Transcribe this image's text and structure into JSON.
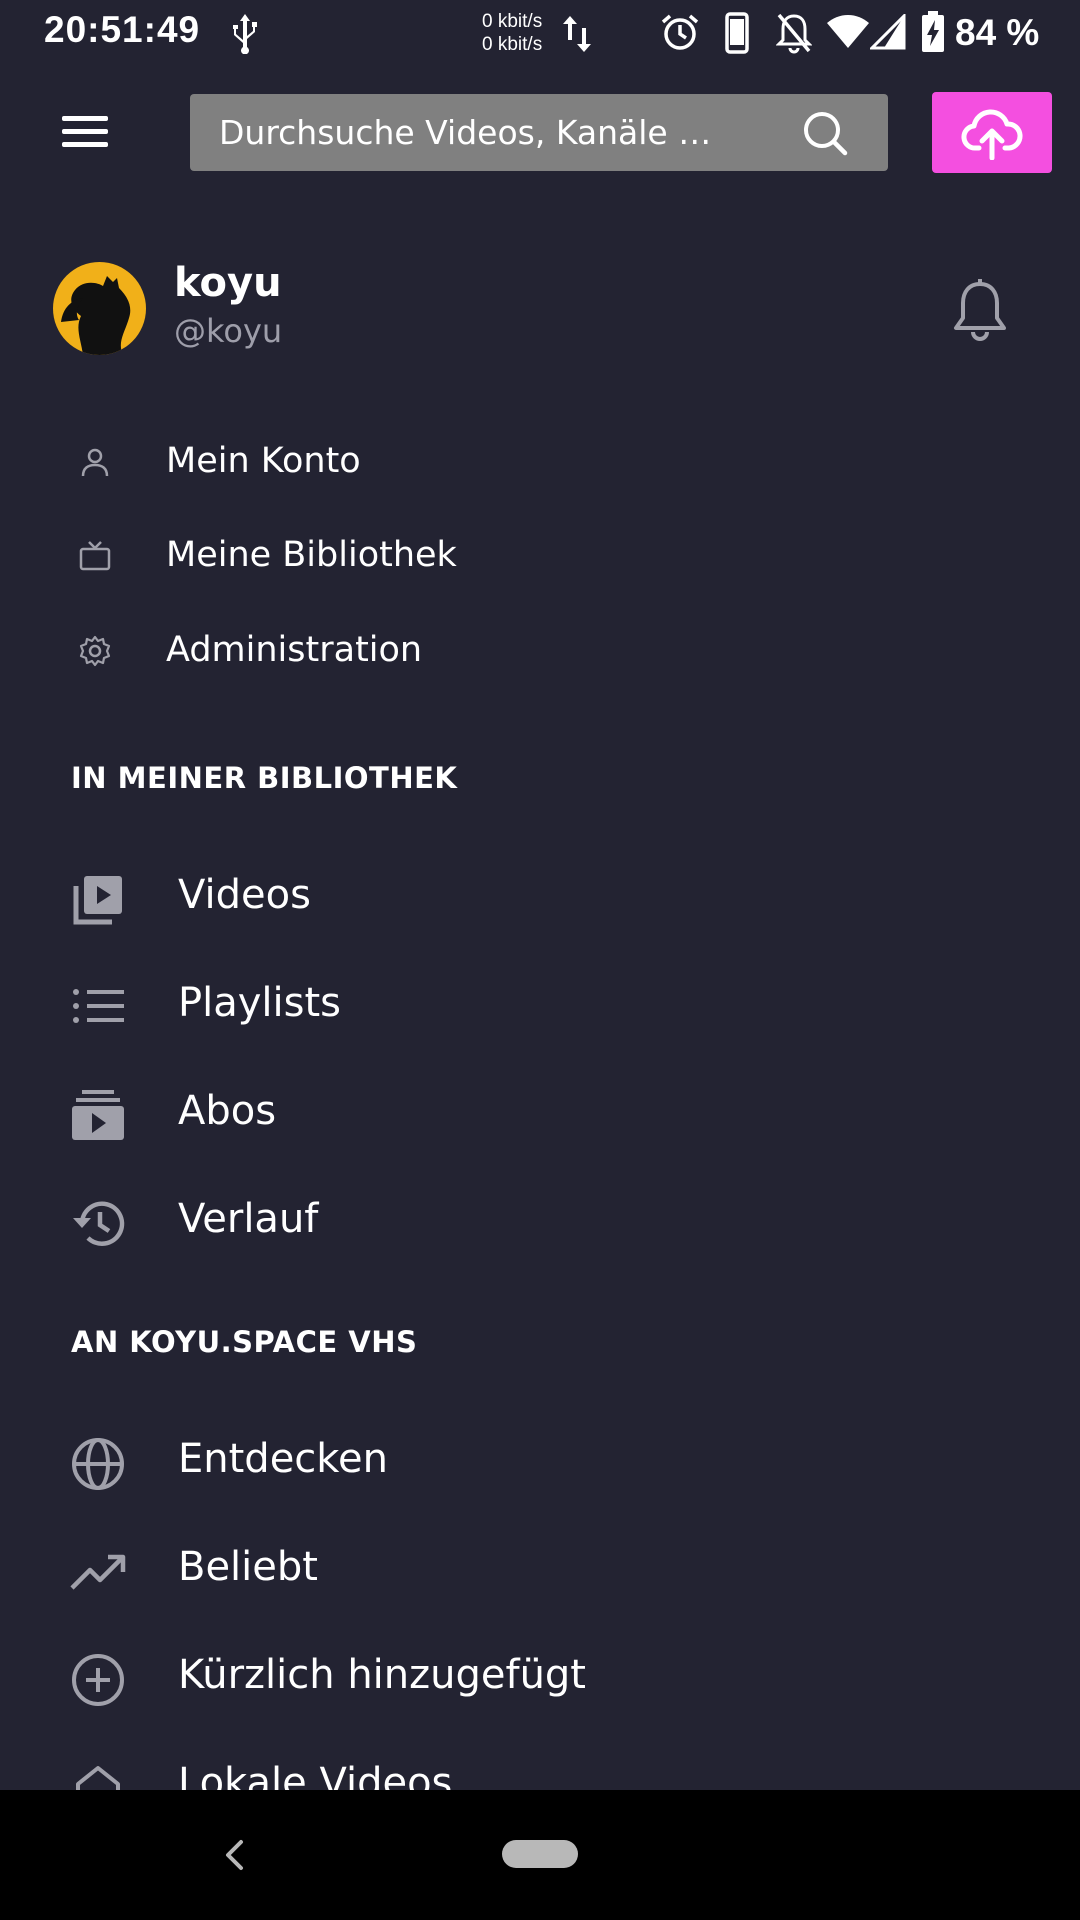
{
  "status_bar": {
    "time": "20:51:49",
    "net_up": "0 kbit/s",
    "net_down": "0 kbit/s",
    "battery": "84 %",
    "icons": [
      "usb-icon",
      "data-transfer-icon",
      "alarm-icon",
      "phone-icon",
      "bell-off-icon",
      "wifi-icon",
      "signal-icon",
      "battery-charging-icon"
    ]
  },
  "header": {
    "search_placeholder": "Durchsuche Videos, Kanäle …",
    "icons": [
      "menu-icon",
      "search-icon",
      "upload-cloud-icon"
    ],
    "upload_color": "#f44fe0"
  },
  "profile": {
    "name": "koyu",
    "handle": "@koyu",
    "avatar_color": "#f1b019"
  },
  "account_menu": [
    {
      "label": "Mein Konto",
      "icon": "user-icon"
    },
    {
      "label": "Meine Bibliothek",
      "icon": "tv-icon"
    },
    {
      "label": "Administration",
      "icon": "gear-icon"
    }
  ],
  "library": {
    "title": "IN MEINER BIBLIOTHEK",
    "items": [
      {
        "label": "Videos",
        "icon": "video-library-icon"
      },
      {
        "label": "Playlists",
        "icon": "list-icon"
      },
      {
        "label": "Abos",
        "icon": "subscriptions-icon"
      },
      {
        "label": "Verlauf",
        "icon": "history-icon"
      }
    ]
  },
  "instance": {
    "title": "AN KOYU.SPACE VHS",
    "items": [
      {
        "label": "Entdecken",
        "icon": "globe-icon"
      },
      {
        "label": "Beliebt",
        "icon": "trending-icon"
      },
      {
        "label": "Kürzlich hinzugefügt",
        "icon": "plus-circle-icon"
      },
      {
        "label": "Lokale Videos",
        "icon": "home-icon"
      }
    ]
  },
  "colors": {
    "background": "#232332",
    "icon_gray": "#a0a0aa"
  }
}
